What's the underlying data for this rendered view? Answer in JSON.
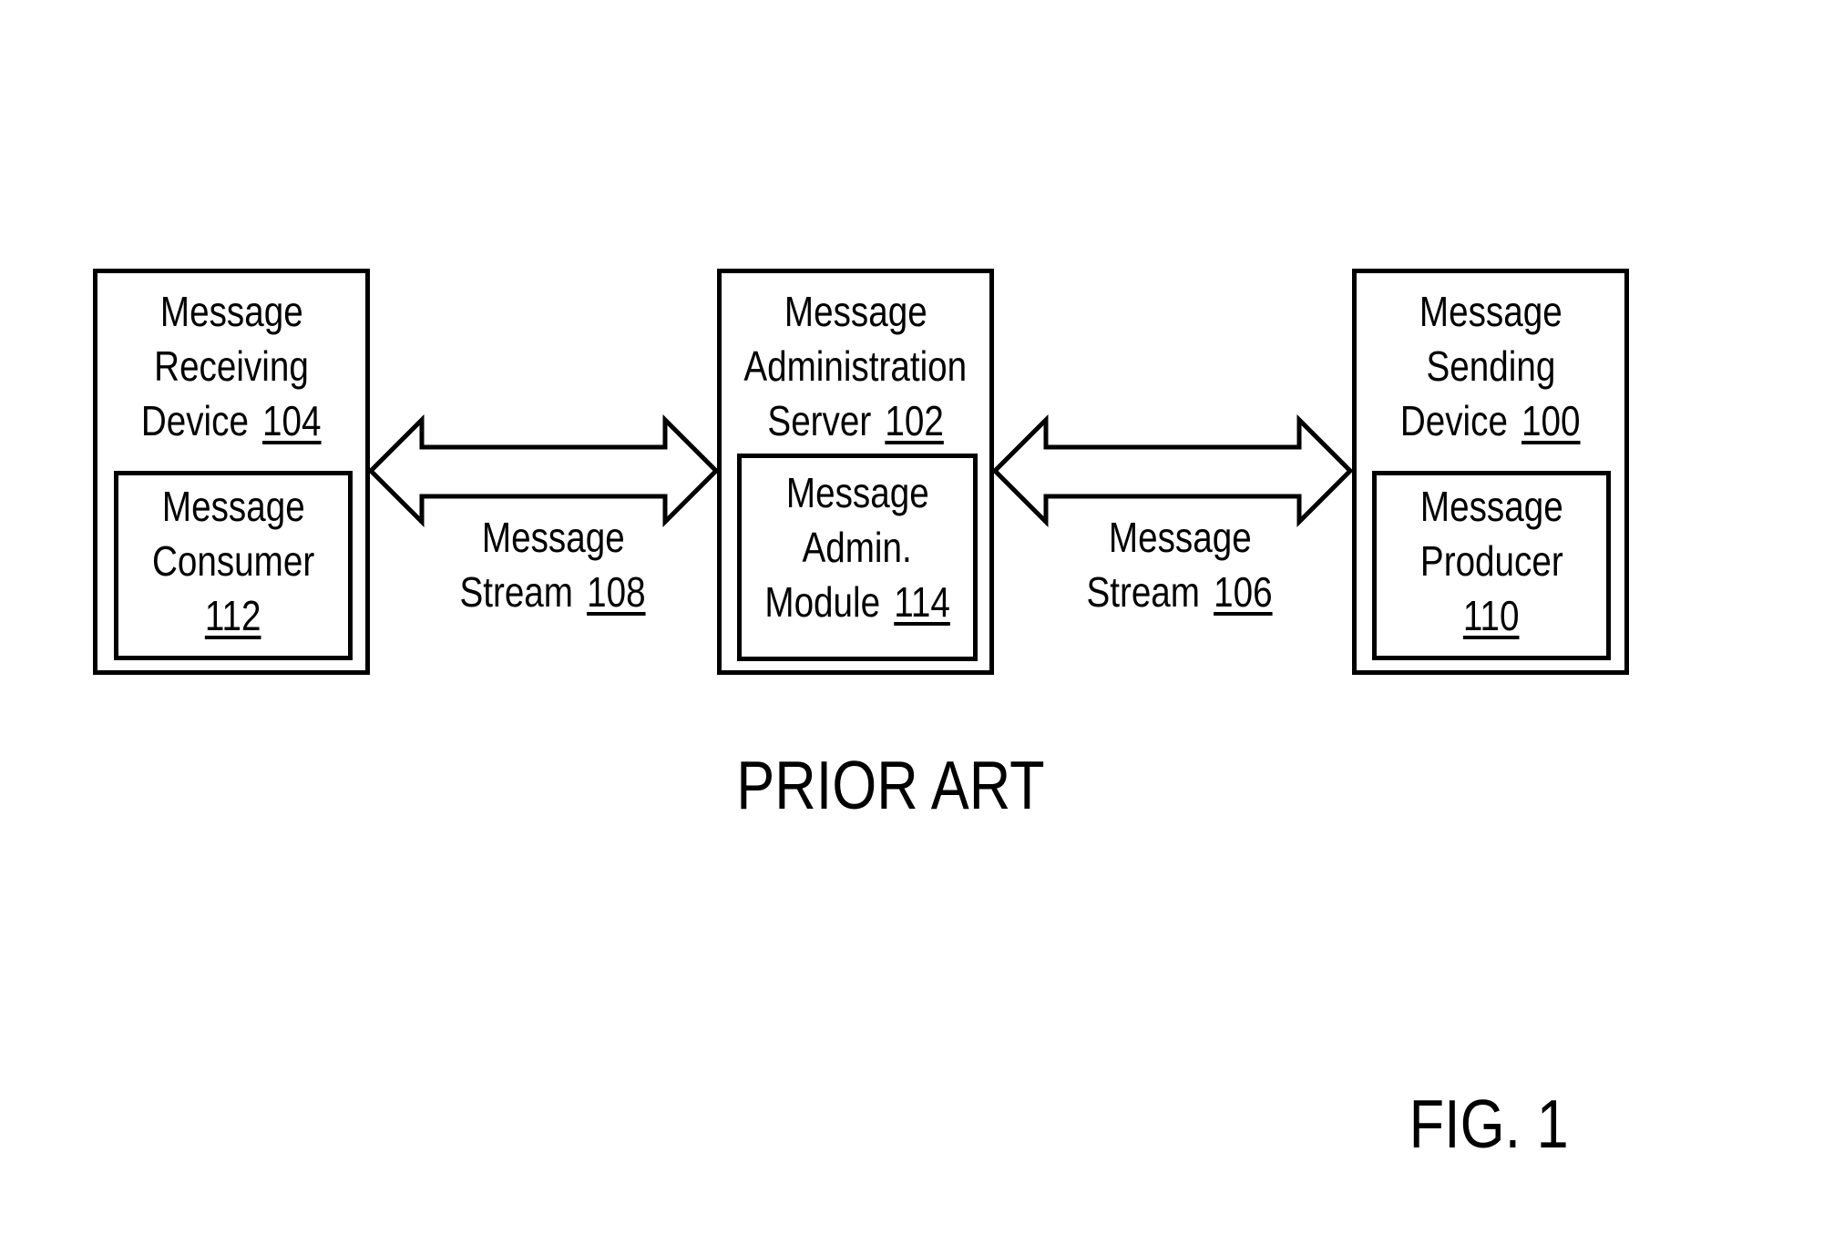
{
  "figure": {
    "caption": "FIG. 1",
    "note": "PRIOR ART"
  },
  "nodes": {
    "receiving_device": {
      "lines": [
        "Message",
        "Receiving",
        "Device"
      ],
      "ref": "104",
      "inner": {
        "lines": [
          "Message",
          "Consumer"
        ],
        "ref": "112"
      }
    },
    "admin_server": {
      "lines": [
        "Message",
        "Administration",
        "Server"
      ],
      "ref": "102",
      "inner": {
        "lines": [
          "Message",
          "Admin.",
          "Module"
        ],
        "ref": "114"
      }
    },
    "sending_device": {
      "lines": [
        "Message",
        "Sending",
        "Device"
      ],
      "ref": "100",
      "inner": {
        "lines": [
          "Message",
          "Producer"
        ],
        "ref": "110"
      }
    }
  },
  "edges": {
    "stream_left": {
      "lines": [
        "Message",
        "Stream"
      ],
      "ref": "108",
      "from": "admin_server",
      "to": "receiving_device",
      "direction": "bidirectional"
    },
    "stream_right": {
      "lines": [
        "Message",
        "Stream"
      ],
      "ref": "106",
      "from": "sending_device",
      "to": "admin_server",
      "direction": "bidirectional"
    }
  }
}
